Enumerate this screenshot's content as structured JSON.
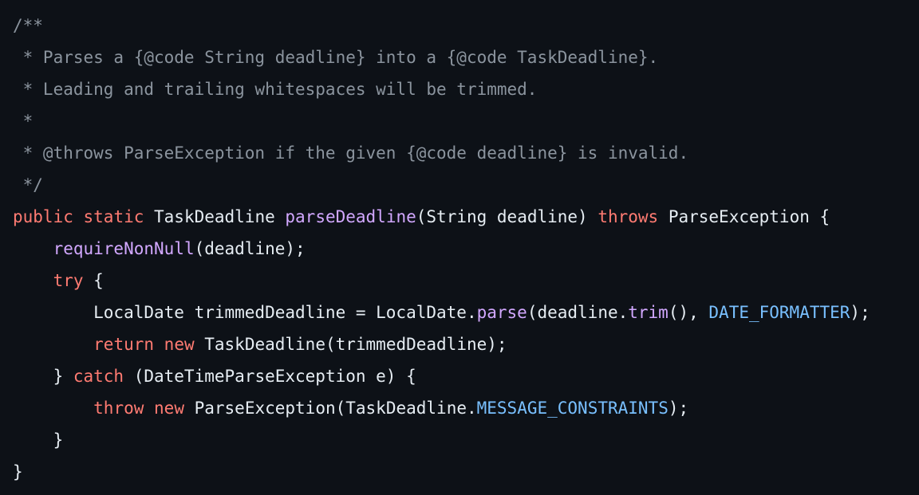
{
  "colors": {
    "background": "#0d1117",
    "plain": "#e6edf3",
    "comment": "#8b949e",
    "keyword": "#ff7b72",
    "function": "#d2a8ff",
    "constant": "#79c0ff"
  },
  "lines": [
    [
      {
        "t": "comment",
        "v": "/**"
      }
    ],
    [
      {
        "t": "comment",
        "v": " * Parses a {@code String deadline} into a {@code TaskDeadline}."
      }
    ],
    [
      {
        "t": "comment",
        "v": " * Leading and trailing whitespaces will be trimmed."
      }
    ],
    [
      {
        "t": "comment",
        "v": " *"
      }
    ],
    [
      {
        "t": "comment",
        "v": " * @throws ParseException if the given {@code deadline} is invalid."
      }
    ],
    [
      {
        "t": "comment",
        "v": " */"
      }
    ],
    [
      {
        "t": "keyword",
        "v": "public"
      },
      {
        "t": "plain",
        "v": " "
      },
      {
        "t": "keyword",
        "v": "static"
      },
      {
        "t": "plain",
        "v": " TaskDeadline "
      },
      {
        "t": "func",
        "v": "parseDeadline"
      },
      {
        "t": "plain",
        "v": "(String deadline) "
      },
      {
        "t": "keyword",
        "v": "throws"
      },
      {
        "t": "plain",
        "v": " ParseException {"
      }
    ],
    [
      {
        "t": "plain",
        "v": "    "
      },
      {
        "t": "func",
        "v": "requireNonNull"
      },
      {
        "t": "plain",
        "v": "(deadline);"
      }
    ],
    [
      {
        "t": "plain",
        "v": "    "
      },
      {
        "t": "keyword",
        "v": "try"
      },
      {
        "t": "plain",
        "v": " {"
      }
    ],
    [
      {
        "t": "plain",
        "v": "        LocalDate trimmedDeadline = LocalDate."
      },
      {
        "t": "func",
        "v": "parse"
      },
      {
        "t": "plain",
        "v": "(deadline."
      },
      {
        "t": "func",
        "v": "trim"
      },
      {
        "t": "plain",
        "v": "(), "
      },
      {
        "t": "const",
        "v": "DATE_FORMATTER"
      },
      {
        "t": "plain",
        "v": ");"
      }
    ],
    [
      {
        "t": "plain",
        "v": "        "
      },
      {
        "t": "keyword",
        "v": "return"
      },
      {
        "t": "plain",
        "v": " "
      },
      {
        "t": "keyword",
        "v": "new"
      },
      {
        "t": "plain",
        "v": " TaskDeadline(trimmedDeadline);"
      }
    ],
    [
      {
        "t": "plain",
        "v": "    } "
      },
      {
        "t": "keyword",
        "v": "catch"
      },
      {
        "t": "plain",
        "v": " (DateTimeParseException e) {"
      }
    ],
    [
      {
        "t": "plain",
        "v": "        "
      },
      {
        "t": "keyword",
        "v": "throw"
      },
      {
        "t": "plain",
        "v": " "
      },
      {
        "t": "keyword",
        "v": "new"
      },
      {
        "t": "plain",
        "v": " ParseException(TaskDeadline."
      },
      {
        "t": "const",
        "v": "MESSAGE_CONSTRAINTS"
      },
      {
        "t": "plain",
        "v": ");"
      }
    ],
    [
      {
        "t": "plain",
        "v": "    }"
      }
    ],
    [
      {
        "t": "plain",
        "v": "}"
      }
    ]
  ]
}
